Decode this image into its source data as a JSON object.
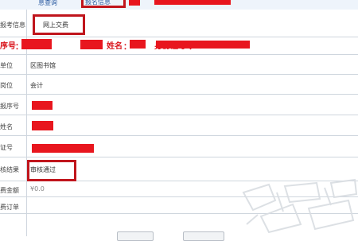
{
  "header": {
    "tab1_text": "息查询",
    "tab2_text": "报名信息"
  },
  "rows": [
    {
      "id": "exam-info",
      "label": "报考信息",
      "value": "网上交费"
    },
    {
      "id": "id-row",
      "label_a": "序号",
      "label_b": "姓名",
      "label_c": "身份证号"
    },
    {
      "id": "unit",
      "label": "单位",
      "value": "区图书馆"
    },
    {
      "id": "position",
      "label": "岗位",
      "value": "会计"
    },
    {
      "id": "seq",
      "label": "报序号",
      "value": ""
    },
    {
      "id": "name",
      "label": "姓名",
      "value": ""
    },
    {
      "id": "idcard",
      "label": "证号",
      "value": ""
    },
    {
      "id": "result",
      "label": "核结果",
      "value": "审核通过"
    },
    {
      "id": "amount",
      "label": "费金额",
      "value": "¥0.0"
    },
    {
      "id": "order",
      "label": "费订单",
      "value": ""
    }
  ]
}
